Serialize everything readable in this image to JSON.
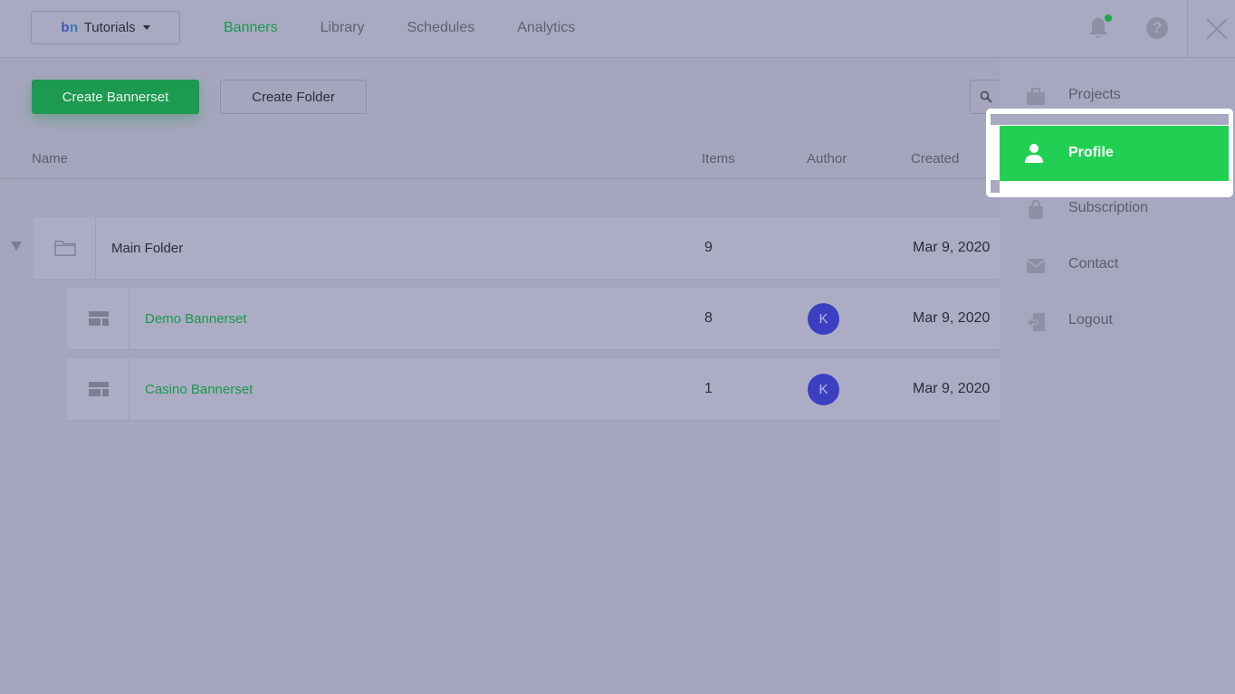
{
  "header": {
    "workspace": {
      "logo_b": "b",
      "logo_n": "n",
      "name": "Tutorials"
    },
    "nav": [
      {
        "label": "Banners",
        "active": true
      },
      {
        "label": "Library",
        "active": false
      },
      {
        "label": "Schedules",
        "active": false
      },
      {
        "label": "Analytics",
        "active": false
      }
    ],
    "help_glyph": "?"
  },
  "toolbar": {
    "create_bannerset": "Create Bannerset",
    "create_folder": "Create Folder"
  },
  "table": {
    "columns": {
      "name": "Name",
      "items": "Items",
      "author": "Author",
      "created": "Created"
    },
    "rows": [
      {
        "type": "folder",
        "name": "Main Folder",
        "items": "9",
        "author": "",
        "created": "Mar 9, 2020"
      },
      {
        "type": "bannerset",
        "name": "Demo Bannerset",
        "items": "8",
        "author": "K",
        "created": "Mar 9, 2020"
      },
      {
        "type": "bannerset",
        "name": "Casino Bannerset",
        "items": "1",
        "author": "K",
        "created": "Mar 9, 2020"
      }
    ]
  },
  "menu": {
    "projects": "Projects",
    "profile": "Profile",
    "subscription": "Subscription",
    "contact": "Contact",
    "logout": "Logout"
  },
  "colors": {
    "accent_green": "#17994d",
    "profile_highlight": "#21d052",
    "avatar": "#3c3fc2"
  }
}
